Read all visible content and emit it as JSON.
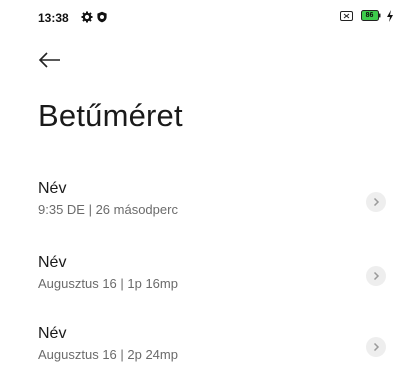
{
  "status_bar": {
    "time": "13:38",
    "battery_level": "86",
    "icons": [
      "gear-icon",
      "shield-icon",
      "sim-icon",
      "battery-icon",
      "charging-icon"
    ]
  },
  "header": {
    "back_icon": "arrow-left-icon",
    "title": "Betűméret"
  },
  "list": {
    "items": [
      {
        "name": "Név",
        "meta": "9:35 DE | 26 másodperc",
        "icon": "chevron-right-icon"
      },
      {
        "name": "Név",
        "meta": "Augusztus 16 | 1p 16mp",
        "icon": "chevron-right-icon"
      },
      {
        "name": "Név",
        "meta": "Augusztus 16 | 2p 24mp",
        "icon": "chevron-right-icon"
      }
    ]
  }
}
